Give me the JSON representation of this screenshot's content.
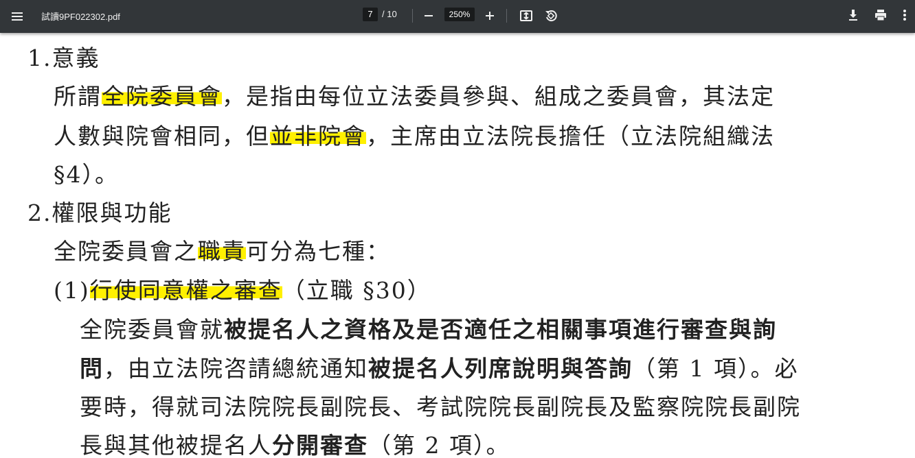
{
  "toolbar": {
    "title": "試讀9PF022302.pdf",
    "page_current": "7",
    "page_total": "/ 10",
    "zoom": "250%",
    "icons": [
      "menu-icon",
      "zoom-out-icon",
      "zoom-in-icon",
      "fit-page-icon",
      "rotate-icon",
      "download-icon",
      "print-icon",
      "more-icon"
    ]
  },
  "document": {
    "lines": [
      {
        "segments": [
          {
            "t": "1.意義",
            "s": ""
          }
        ]
      },
      {
        "segments": [
          {
            "t": "所謂",
            "s": ""
          },
          {
            "t": "全院委員會",
            "s": "hl"
          },
          {
            "t": "，是指由每位立法委員參與、組成之委員會，其法定",
            "s": ""
          }
        ]
      },
      {
        "segments": [
          {
            "t": "人數與院會相同，但",
            "s": ""
          },
          {
            "t": "並非院會",
            "s": "hl"
          },
          {
            "t": "，主席由立法院長擔任（立法院組織法",
            "s": ""
          }
        ]
      },
      {
        "segments": [
          {
            "t": "§4）。",
            "s": ""
          }
        ]
      },
      {
        "segments": [
          {
            "t": "2.權限與功能",
            "s": ""
          }
        ]
      },
      {
        "segments": [
          {
            "t": "全院委員會之",
            "s": ""
          },
          {
            "t": "職責",
            "s": "hl"
          },
          {
            "t": "可分為七種：",
            "s": ""
          }
        ]
      },
      {
        "segments": [
          {
            "t": "(1)",
            "s": ""
          },
          {
            "t": "行使同意權之審查",
            "s": "hl"
          },
          {
            "t": "（立職 §30）",
            "s": ""
          }
        ]
      },
      {
        "segments": [
          {
            "t": "全院委員會就",
            "s": ""
          },
          {
            "t": "被提名人之資格及是否適任之相關事項進行審查與詢",
            "s": "b"
          }
        ]
      },
      {
        "segments": [
          {
            "t": "問",
            "s": "b"
          },
          {
            "t": "，由立法院咨請總統通知",
            "s": ""
          },
          {
            "t": "被提名人列席說明與答詢",
            "s": "b"
          },
          {
            "t": "（第 1 項）。必",
            "s": ""
          }
        ]
      },
      {
        "segments": [
          {
            "t": "要時，得就司法院院長副院長、考試院院長副院長及監察院院長副院",
            "s": ""
          }
        ]
      },
      {
        "segments": [
          {
            "t": "長與其他被提名人",
            "s": ""
          },
          {
            "t": "分開審查",
            "s": "b"
          },
          {
            "t": "（第 2 項）。",
            "s": ""
          }
        ]
      }
    ]
  }
}
